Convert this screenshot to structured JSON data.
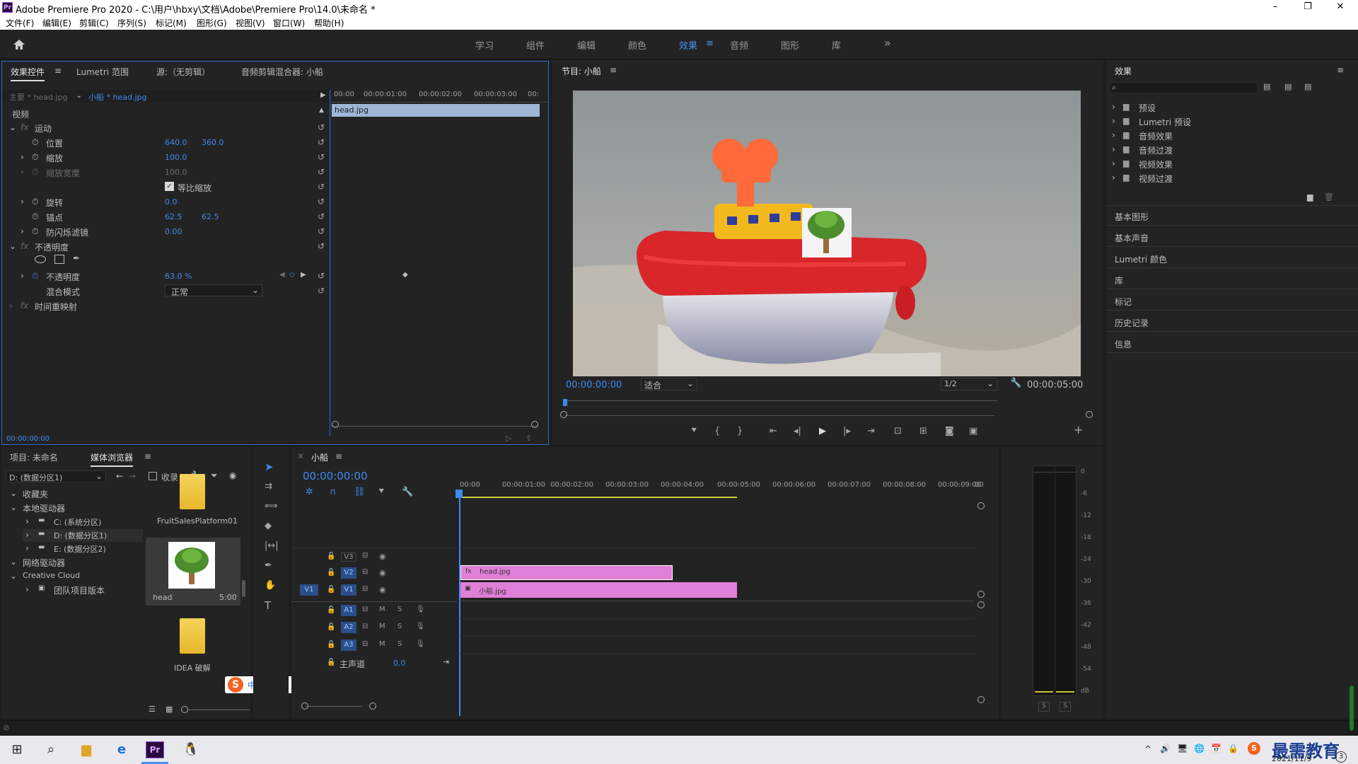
{
  "window": {
    "app_icon": "Pr",
    "title": "Adobe Premiere Pro 2020 - C:\\用户\\hbxy\\文档\\Adobe\\Premiere Pro\\14.0\\未命名 *",
    "min": "–",
    "max": "❐",
    "close": "✕"
  },
  "menu": [
    "文件(F)",
    "编辑(E)",
    "剪辑(C)",
    "序列(S)",
    "标记(M)",
    "图形(G)",
    "视图(V)",
    "窗口(W)",
    "帮助(H)"
  ],
  "workspaces": [
    "学习",
    "组件",
    "编辑",
    "颜色",
    "效果",
    "音频",
    "图形",
    "库"
  ],
  "workspace_active": "效果",
  "workspace_more": "»",
  "effect_controls": {
    "tabs": [
      "效果控件",
      "Lumetri 范围",
      "源:（无剪辑）",
      "音频剪辑混合器: 小船"
    ],
    "master": "主要 * head.jpg",
    "sequence": "小船 * head.jpg",
    "ruler": [
      "00:00",
      "00:00:01:00",
      "00:00:02:00",
      "00:00:03:00",
      "00:"
    ],
    "clip_bar": "head.jpg",
    "section_video": "视频",
    "motion": "运动",
    "position_label": "位置",
    "position_x": "640.0",
    "position_y": "360.0",
    "scale_label": "缩放",
    "scale": "100.0",
    "scale_width_label": "缩放宽度",
    "scale_width": "100.0",
    "uniform_scale": "等比缩放",
    "rotation_label": "旋转",
    "rotation": "0.0",
    "anchor_label": "锚点",
    "anchor_x": "62.5",
    "anchor_y": "62.5",
    "antiflicker_label": "防闪烁滤镜",
    "antiflicker": "0.00",
    "opacity_group": "不透明度",
    "opacity_label": "不透明度",
    "opacity": "63.0 %",
    "blend_label": "混合模式",
    "blend": "正常",
    "time_remap": "时间重映射",
    "timecode": "00:00:00:00"
  },
  "program": {
    "title": "节目: 小船",
    "timecode": "00:00:00:00",
    "fit": "适合",
    "resolution": "1/2",
    "duration": "00:00:05:00"
  },
  "effects_panel": {
    "title": "效果",
    "folders": [
      "预设",
      "Lumetri 预设",
      "音频效果",
      "音频过渡",
      "视频效果",
      "视频过渡"
    ],
    "sections": [
      "基本图形",
      "基本声音",
      "Lumetri 颜色",
      "库",
      "标记",
      "历史记录",
      "信息"
    ]
  },
  "project": {
    "tabs": [
      "项目: 未命名",
      "媒体浏览器"
    ],
    "drive": "D: (数据分区1)",
    "ingest": "收录",
    "tree": [
      "收藏夹",
      "本地驱动器",
      "C: (系统分区)",
      "D: (数据分区1)",
      "E: (数据分区2)",
      "网络驱动器",
      "Creative Cloud",
      "团队项目版本"
    ],
    "items": [
      {
        "name": "FruitSalesPlatform01",
        "duration": ""
      },
      {
        "name": "head",
        "duration": "5:00"
      },
      {
        "name": "IDEA 破解",
        "duration": ""
      }
    ]
  },
  "ime": {
    "logo": "S",
    "buttons": [
      "中",
      "°,",
      "☺",
      "🎤",
      "⌨",
      "👤",
      "👕",
      "▦"
    ]
  },
  "timeline": {
    "title": "小船",
    "timecode": "00:00:00:00",
    "ruler": [
      "00:00",
      "00:00:01:00",
      "00:00:02:00",
      "00:00:03:00",
      "00:00:04:00",
      "00:00:05:00",
      "00:00:06:00",
      "00:00:07:00",
      "00:00:08:00",
      "00:00:09:00",
      "00"
    ],
    "video_tracks": [
      "V3",
      "V2",
      "V1"
    ],
    "audio_tracks": [
      "A1",
      "A2",
      "A3"
    ],
    "source_patch": "V1",
    "master": "主声道",
    "master_value": "0.0",
    "clip_v2": "head.jpg",
    "clip_v1": "小船.jpg",
    "mute": "M",
    "solo": "S"
  },
  "meters": {
    "scale": [
      "0",
      "-6",
      "-12",
      "-18",
      "-24",
      "-30",
      "-36",
      "-42",
      "-48",
      "-54",
      "dB"
    ],
    "solo_l": "S",
    "solo_r": "S"
  },
  "taskbar": {
    "date": "2021/11/9",
    "watermark": "最需教育",
    "tray": [
      "^",
      "🔊",
      "🖥",
      "🌐",
      "📅",
      "🔒"
    ]
  },
  "colors": {
    "accent": "#3c8cf0",
    "clip_pink": "#e07fd8",
    "clip_bar": "#9fb6d6",
    "panel": "#232323",
    "bg": "#1d1d1d"
  }
}
